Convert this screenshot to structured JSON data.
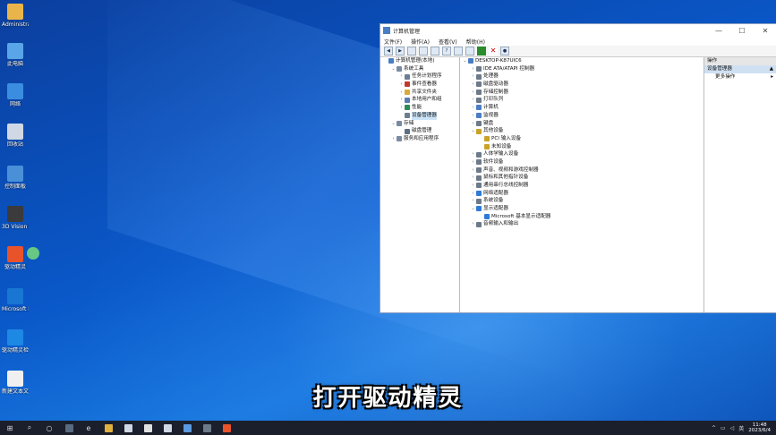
{
  "desktop": {
    "icons": [
      {
        "label": "Administrator",
        "color": "#e9b54a"
      },
      {
        "label": "此电脑",
        "color": "#5aa4e8"
      },
      {
        "label": "网络",
        "color": "#3b8de0"
      },
      {
        "label": "回收站",
        "color": "#cfd8e4"
      },
      {
        "label": "控制面板",
        "color": "#4a90d9"
      },
      {
        "label": "3D Vision Photo Viewer",
        "color": "#3b3b3b"
      },
      {
        "label": "驱动精灵",
        "color": "#e8532a"
      },
      {
        "label": "Microsoft Edge",
        "color": "#1976d2"
      },
      {
        "label": "驱动精灵检测",
        "color": "#1e88e5"
      },
      {
        "label": "新建文本文档",
        "color": "#f0f0f0"
      }
    ]
  },
  "window": {
    "title": "计算机管理",
    "min": "—",
    "max": "☐",
    "close": "✕",
    "menu": [
      "文件(F)",
      "操作(A)",
      "查看(V)",
      "帮助(H)"
    ],
    "left_tree": [
      {
        "label": "计算机管理(本地)",
        "indent": 0,
        "expander": "",
        "color": "#4a7ec4"
      },
      {
        "label": "系统工具",
        "indent": 1,
        "expander": "⌄",
        "color": "#7a8aa0"
      },
      {
        "label": "任务计划程序",
        "indent": 2,
        "expander": "›",
        "color": "#6a7f95"
      },
      {
        "label": "事件查看器",
        "indent": 2,
        "expander": "›",
        "color": "#c0392b"
      },
      {
        "label": "共享文件夹",
        "indent": 2,
        "expander": "›",
        "color": "#d9a93a"
      },
      {
        "label": "本地用户和组",
        "indent": 2,
        "expander": "›",
        "color": "#5a7ab0"
      },
      {
        "label": "性能",
        "indent": 2,
        "expander": "›",
        "color": "#2e8b57"
      },
      {
        "label": "设备管理器",
        "indent": 2,
        "expander": "",
        "color": "#6d7d90",
        "selected": true
      },
      {
        "label": "存储",
        "indent": 1,
        "expander": "⌄",
        "color": "#7a8aa0"
      },
      {
        "label": "磁盘管理",
        "indent": 2,
        "expander": "",
        "color": "#5c6e82"
      },
      {
        "label": "服务和应用程序",
        "indent": 1,
        "expander": "›",
        "color": "#7a8aa0"
      }
    ],
    "device_tree": [
      {
        "label": "DESKTOP-K87UIC6",
        "indent": 0,
        "expander": "⌄",
        "color": "#4a7ec4"
      },
      {
        "label": "IDE ATA/ATAPI 控制器",
        "indent": 1,
        "expander": "›",
        "color": "#6c7a89"
      },
      {
        "label": "处理器",
        "indent": 1,
        "expander": "›",
        "color": "#6c7a89"
      },
      {
        "label": "磁盘驱动器",
        "indent": 1,
        "expander": "›",
        "color": "#6c7a89"
      },
      {
        "label": "存储控制器",
        "indent": 1,
        "expander": "›",
        "color": "#6c7a89"
      },
      {
        "label": "打印队列",
        "indent": 1,
        "expander": "›",
        "color": "#6c7a89"
      },
      {
        "label": "计算机",
        "indent": 1,
        "expander": "›",
        "color": "#4a7ec4"
      },
      {
        "label": "监视器",
        "indent": 1,
        "expander": "›",
        "color": "#4a7ec4"
      },
      {
        "label": "键盘",
        "indent": 1,
        "expander": "›",
        "color": "#6c7a89"
      },
      {
        "label": "其他设备",
        "indent": 1,
        "expander": "⌄",
        "color": "#c9a227"
      },
      {
        "label": "PCI 输入设备",
        "indent": 2,
        "expander": "",
        "color": "#c9a227"
      },
      {
        "label": "未知设备",
        "indent": 2,
        "expander": "",
        "color": "#c9a227"
      },
      {
        "label": "人体学输入设备",
        "indent": 1,
        "expander": "›",
        "color": "#6c7a89"
      },
      {
        "label": "软件设备",
        "indent": 1,
        "expander": "›",
        "color": "#6c7a89"
      },
      {
        "label": "声音、视频和游戏控制器",
        "indent": 1,
        "expander": "›",
        "color": "#6c7a89"
      },
      {
        "label": "鼠标和其他指针设备",
        "indent": 1,
        "expander": "›",
        "color": "#6c7a89"
      },
      {
        "label": "通用串行总线控制器",
        "indent": 1,
        "expander": "›",
        "color": "#6c7a89"
      },
      {
        "label": "网络适配器",
        "indent": 1,
        "expander": "›",
        "color": "#2e7bd6"
      },
      {
        "label": "系统设备",
        "indent": 1,
        "expander": "›",
        "color": "#6c7a89"
      },
      {
        "label": "显示适配器",
        "indent": 1,
        "expander": "⌄",
        "color": "#2e7bd6"
      },
      {
        "label": "Microsoft 基本显示适配器",
        "indent": 2,
        "expander": "",
        "color": "#2e7bd6"
      },
      {
        "label": "音频输入和输出",
        "indent": 1,
        "expander": "›",
        "color": "#6c7a89"
      }
    ],
    "actions": {
      "header": "操作",
      "section": "设备管理器",
      "item": "更多操作"
    }
  },
  "subtitle": "打开驱动精灵",
  "taskbar": {
    "apps": [
      {
        "name": "start-button",
        "glyph": "⊞",
        "color": ""
      },
      {
        "name": "search-button",
        "glyph": "⌕",
        "color": ""
      },
      {
        "name": "task-view-button",
        "glyph": "○",
        "color": ""
      },
      {
        "name": "taskbar-task-view",
        "glyph": "",
        "color": "#5a6a80"
      },
      {
        "name": "taskbar-edge",
        "glyph": "e",
        "color": ""
      },
      {
        "name": "taskbar-explorer",
        "glyph": "",
        "color": "#e0b040"
      },
      {
        "name": "taskbar-store",
        "glyph": "",
        "color": "#cfd8e4"
      },
      {
        "name": "taskbar-mail",
        "glyph": "",
        "color": "#e0e0e0"
      },
      {
        "name": "taskbar-security",
        "glyph": "",
        "color": "#cfd8e4"
      },
      {
        "name": "taskbar-shield",
        "glyph": "",
        "color": "#5a9ae0"
      },
      {
        "name": "taskbar-computer-management",
        "glyph": "",
        "color": "#6c7a89"
      },
      {
        "name": "taskbar-driver-genius",
        "glyph": "",
        "color": "#e8532a"
      }
    ],
    "tray_chevron": "^",
    "tray_network": "▭",
    "tray_volume": "◁",
    "tray_ime": "英",
    "time": "11:48",
    "date": "2023/6/4"
  }
}
